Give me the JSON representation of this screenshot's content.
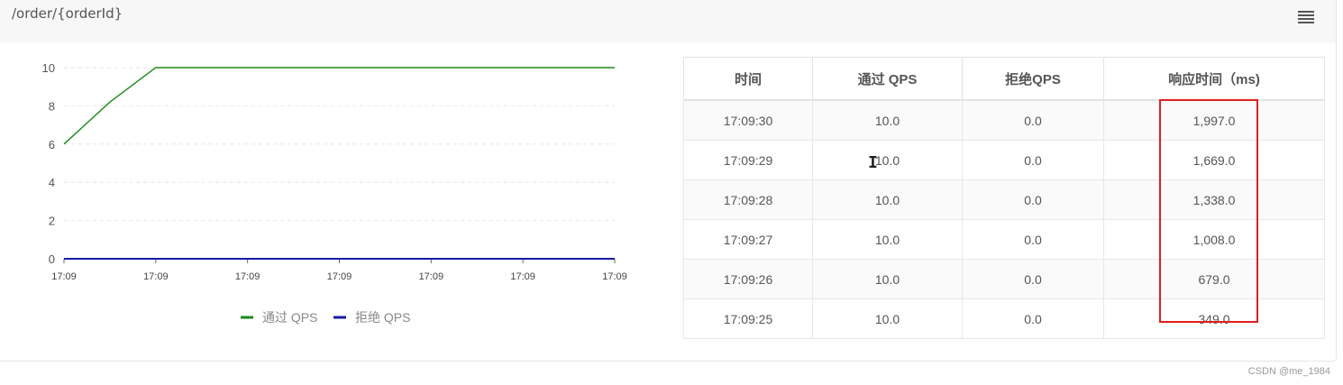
{
  "panel": {
    "title": "/order/{orderId}",
    "menu_icon": "hamburger-menu-icon"
  },
  "chart_data": {
    "type": "line",
    "x": [
      "17:09",
      "17:09",
      "17:09",
      "17:09",
      "17:09",
      "17:09",
      "17:09"
    ],
    "y_ticks": [
      0,
      2,
      4,
      6,
      8,
      10
    ],
    "ylim": [
      0,
      10
    ],
    "series": [
      {
        "name": "通过 QPS",
        "color": "#1a8a1a",
        "points": [
          [
            0,
            6
          ],
          [
            0.5,
            8.2
          ],
          [
            1,
            10
          ],
          [
            2,
            10
          ],
          [
            3,
            10
          ],
          [
            4,
            10
          ],
          [
            5,
            10
          ],
          [
            6,
            10
          ]
        ]
      },
      {
        "name": "拒绝 QPS",
        "color": "#1a1aa8",
        "points": [
          [
            0,
            0
          ],
          [
            1,
            0
          ],
          [
            2,
            0
          ],
          [
            3,
            0
          ],
          [
            4,
            0
          ],
          [
            5,
            0
          ],
          [
            6,
            0
          ]
        ]
      }
    ],
    "legend_position": "bottom-center",
    "grid": true
  },
  "table": {
    "headers": [
      "时间",
      "通过 QPS",
      "拒绝QPS",
      "响应时间（ms)"
    ],
    "rows": [
      [
        "17:09:30",
        "10.0",
        "0.0",
        "1,997.0"
      ],
      [
        "17:09:29",
        "10.0",
        "0.0",
        "1,669.0"
      ],
      [
        "17:09:28",
        "10.0",
        "0.0",
        "1,338.0"
      ],
      [
        "17:09:27",
        "10.0",
        "0.0",
        "1,008.0"
      ],
      [
        "17:09:26",
        "10.0",
        "0.0",
        "679.0"
      ],
      [
        "17:09:25",
        "10.0",
        "0.0",
        "349.0"
      ]
    ]
  },
  "cursor_glyph": "I",
  "colors": {
    "highlight": "#e02020",
    "pass": "#1a8a1a",
    "block": "#1a1aa8"
  },
  "watermark": "CSDN @me_1984"
}
